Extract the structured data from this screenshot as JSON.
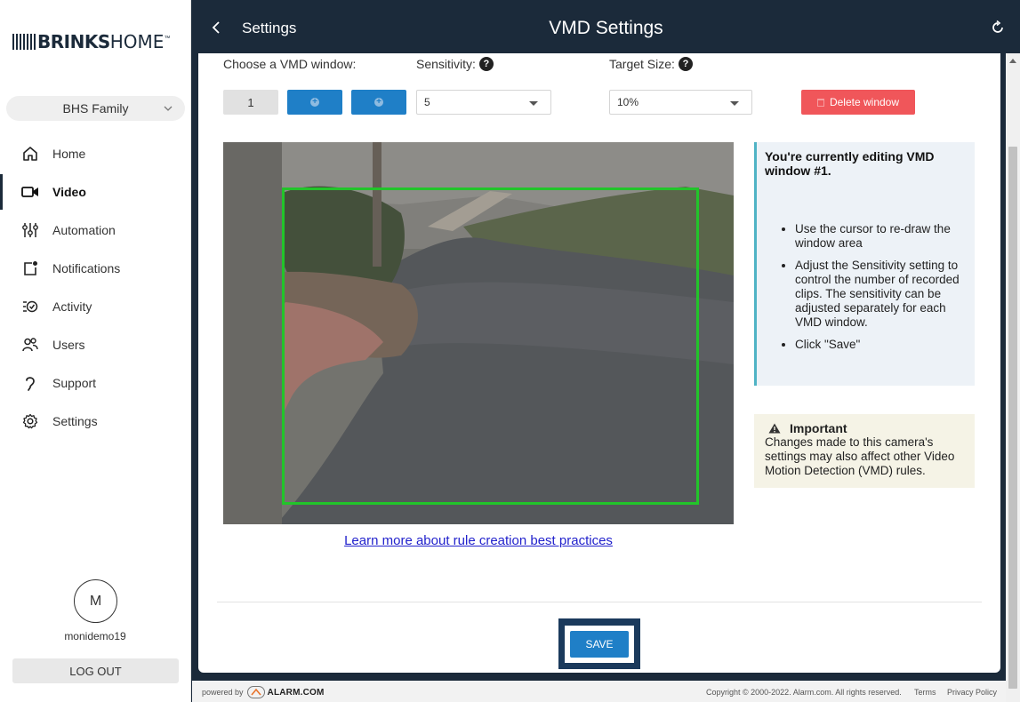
{
  "brand": {
    "bold": "BRINKS",
    "light": "HOME",
    "tm": "™"
  },
  "sidebar": {
    "account_selector": "BHS Family",
    "items": [
      {
        "label": "Home",
        "icon": "home-icon"
      },
      {
        "label": "Video",
        "icon": "video-icon",
        "active": true
      },
      {
        "label": "Automation",
        "icon": "sliders-icon"
      },
      {
        "label": "Notifications",
        "icon": "notification-icon"
      },
      {
        "label": "Activity",
        "icon": "activity-icon"
      },
      {
        "label": "Users",
        "icon": "users-icon"
      },
      {
        "label": "Support",
        "icon": "support-icon"
      },
      {
        "label": "Settings",
        "icon": "gear-icon"
      }
    ],
    "user": {
      "initial": "M",
      "name": "monidemo19"
    },
    "logout_label": "LOG OUT"
  },
  "header": {
    "back_label": "Settings",
    "title": "VMD Settings",
    "refresh_icon": "refresh-icon"
  },
  "controls": {
    "window_label": "Choose a VMD window:",
    "windows": [
      "1"
    ],
    "sensitivity_label": "Sensitivity:",
    "sensitivity_value": "5",
    "target_size_label": "Target Size:",
    "target_size_value": "10%",
    "delete_label": "Delete window"
  },
  "info": {
    "title": "You're currently editing VMD window #1.",
    "bullets": [
      "Use the cursor to re-draw the window area",
      "Adjust the Sensitivity setting to control the number of recorded clips. The sensitivity can be adjusted separately for each VMD window.",
      "Click \"Save\""
    ]
  },
  "important": {
    "title": "Important",
    "text": "Changes made to this camera's settings may also affect other Video Motion Detection (VMD) rules."
  },
  "learn_link": "Learn more about rule creation best practices",
  "save_label": "SAVE",
  "footer": {
    "powered_by": "powered by",
    "alarm_logo": "ALARM.COM",
    "copyright": "Copyright © 2000-2022. Alarm.com. All rights reserved.",
    "terms": "Terms",
    "privacy": "Privacy Policy"
  },
  "colors": {
    "navy": "#1b2a3a",
    "primary_blue": "#1f7fc7",
    "delete_red": "#f0565a",
    "vmd_green": "#22c42a",
    "info_accent": "#4fb3c5"
  }
}
